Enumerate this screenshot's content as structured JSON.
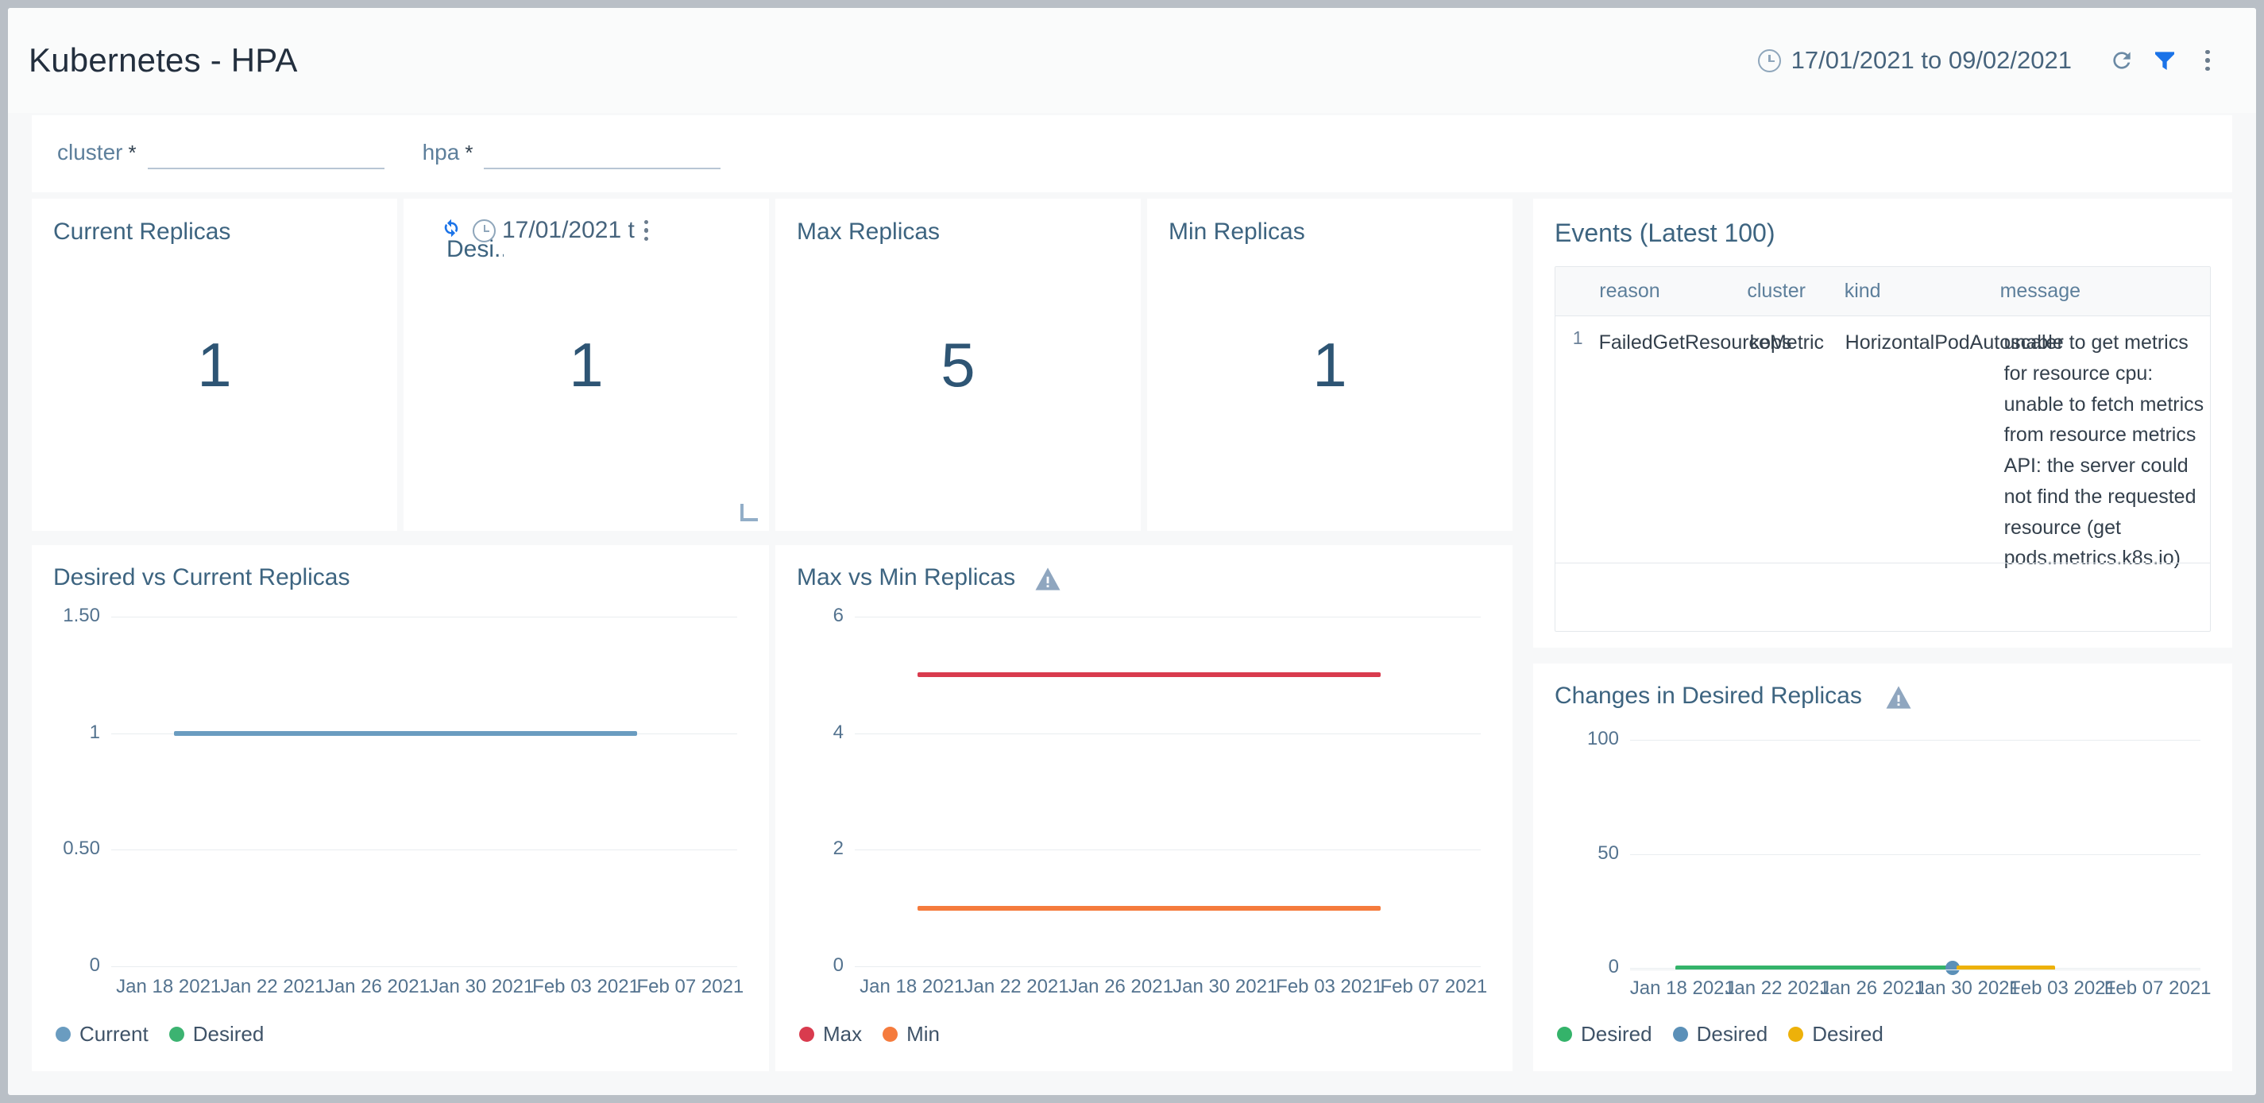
{
  "header": {
    "title": "Kubernetes - HPA",
    "date_range": "17/01/2021 to 09/02/2021",
    "clock_icon": "clock-icon",
    "refresh_icon": "refresh-icon",
    "filter_icon": "filter-icon",
    "more_icon": "kebab-menu-icon",
    "filter_icon_color": "#1a73e8"
  },
  "filters": [
    {
      "label": "cluster",
      "required": "*",
      "value": "",
      "placeholder": ""
    },
    {
      "label": "hpa",
      "required": "*",
      "value": "",
      "placeholder": ""
    }
  ],
  "stats": [
    {
      "title": "Current Replicas",
      "value": "1"
    },
    {
      "title": "Desired Replicas",
      "title_truncated": "Desi...",
      "value": "1",
      "hover_date": "17/01/2021 t"
    },
    {
      "title": "Max Replicas",
      "value": "5"
    },
    {
      "title": "Min Replicas",
      "value": "1"
    }
  ],
  "events": {
    "title": "Events (Latest 100)",
    "columns": [
      "reason",
      "cluster",
      "kind",
      "message"
    ],
    "rows": [
      {
        "index": "1",
        "reason": "FailedGetResourceMetric",
        "cluster": "kops",
        "kind": "HorizontalPodAutoscaler",
        "message": "unable to get metrics for resource cpu: unable to fetch metrics from resource metrics API: the server could not find the requested resource (get pods.metrics.k8s.io)"
      }
    ]
  },
  "chart_data": [
    {
      "id": "desired-vs-current",
      "type": "line",
      "title": "Desired vs Current Replicas",
      "xlabel": "",
      "ylabel": "",
      "yticks": [
        "0",
        "0.50",
        "1",
        "1.50"
      ],
      "ylim": [
        0,
        1.5
      ],
      "xticks": [
        "Jan 18 2021",
        "Jan 22 2021",
        "Jan 26 2021",
        "Jan 30 2021",
        "Feb 03 2021",
        "Feb 07 2021"
      ],
      "grid": true,
      "legend_position": "bottom-left",
      "warning": false,
      "series": [
        {
          "name": "Current",
          "color": "#6a9cc0",
          "constant_value": 1,
          "x_start_frac": 0.1,
          "x_end_frac": 0.84,
          "visible": true
        },
        {
          "name": "Desired",
          "color": "#3cb371",
          "constant_value": 1,
          "visible": false
        }
      ]
    },
    {
      "id": "max-vs-min",
      "type": "line",
      "title": "Max vs Min Replicas",
      "xlabel": "",
      "ylabel": "",
      "yticks": [
        "0",
        "2",
        "4",
        "6"
      ],
      "ylim": [
        0,
        6
      ],
      "xticks": [
        "Jan 18 2021",
        "Jan 22 2021",
        "Jan 26 2021",
        "Jan 30 2021",
        "Feb 03 2021",
        "Feb 07 2021"
      ],
      "grid": true,
      "legend_position": "bottom-left",
      "warning": true,
      "series": [
        {
          "name": "Max",
          "color": "#d93b4e",
          "constant_value": 5,
          "x_start_frac": 0.1,
          "x_end_frac": 0.84,
          "visible": true
        },
        {
          "name": "Min",
          "color": "#f57b3d",
          "constant_value": 1,
          "x_start_frac": 0.1,
          "x_end_frac": 0.84,
          "visible": true
        }
      ]
    },
    {
      "id": "changes-in-desired",
      "type": "line",
      "title": "Changes in Desired Replicas",
      "xlabel": "",
      "ylabel": "",
      "yticks": [
        "0",
        "50",
        "100"
      ],
      "ylim": [
        0,
        100
      ],
      "xticks": [
        "Jan 18 2021",
        "Jan 22 2021",
        "Jan 26 2021",
        "Jan 30 2021",
        "Feb 03 2021",
        "Feb 07 2021"
      ],
      "grid": true,
      "legend_position": "bottom-left",
      "warning": true,
      "series": [
        {
          "name": "Desired",
          "color": "#34b36a",
          "constant_value": 0,
          "x_start_frac": 0.08,
          "x_end_frac": 0.565,
          "visible": true
        },
        {
          "name": "Desired",
          "color": "#5b90b8",
          "constant_value": 0,
          "x_start_frac": 0.555,
          "x_end_frac": 0.575,
          "visible": true
        },
        {
          "name": "Desired",
          "color": "#edb10a",
          "constant_value": 0,
          "x_start_frac": 0.572,
          "x_end_frac": 0.745,
          "visible": true
        }
      ]
    }
  ]
}
